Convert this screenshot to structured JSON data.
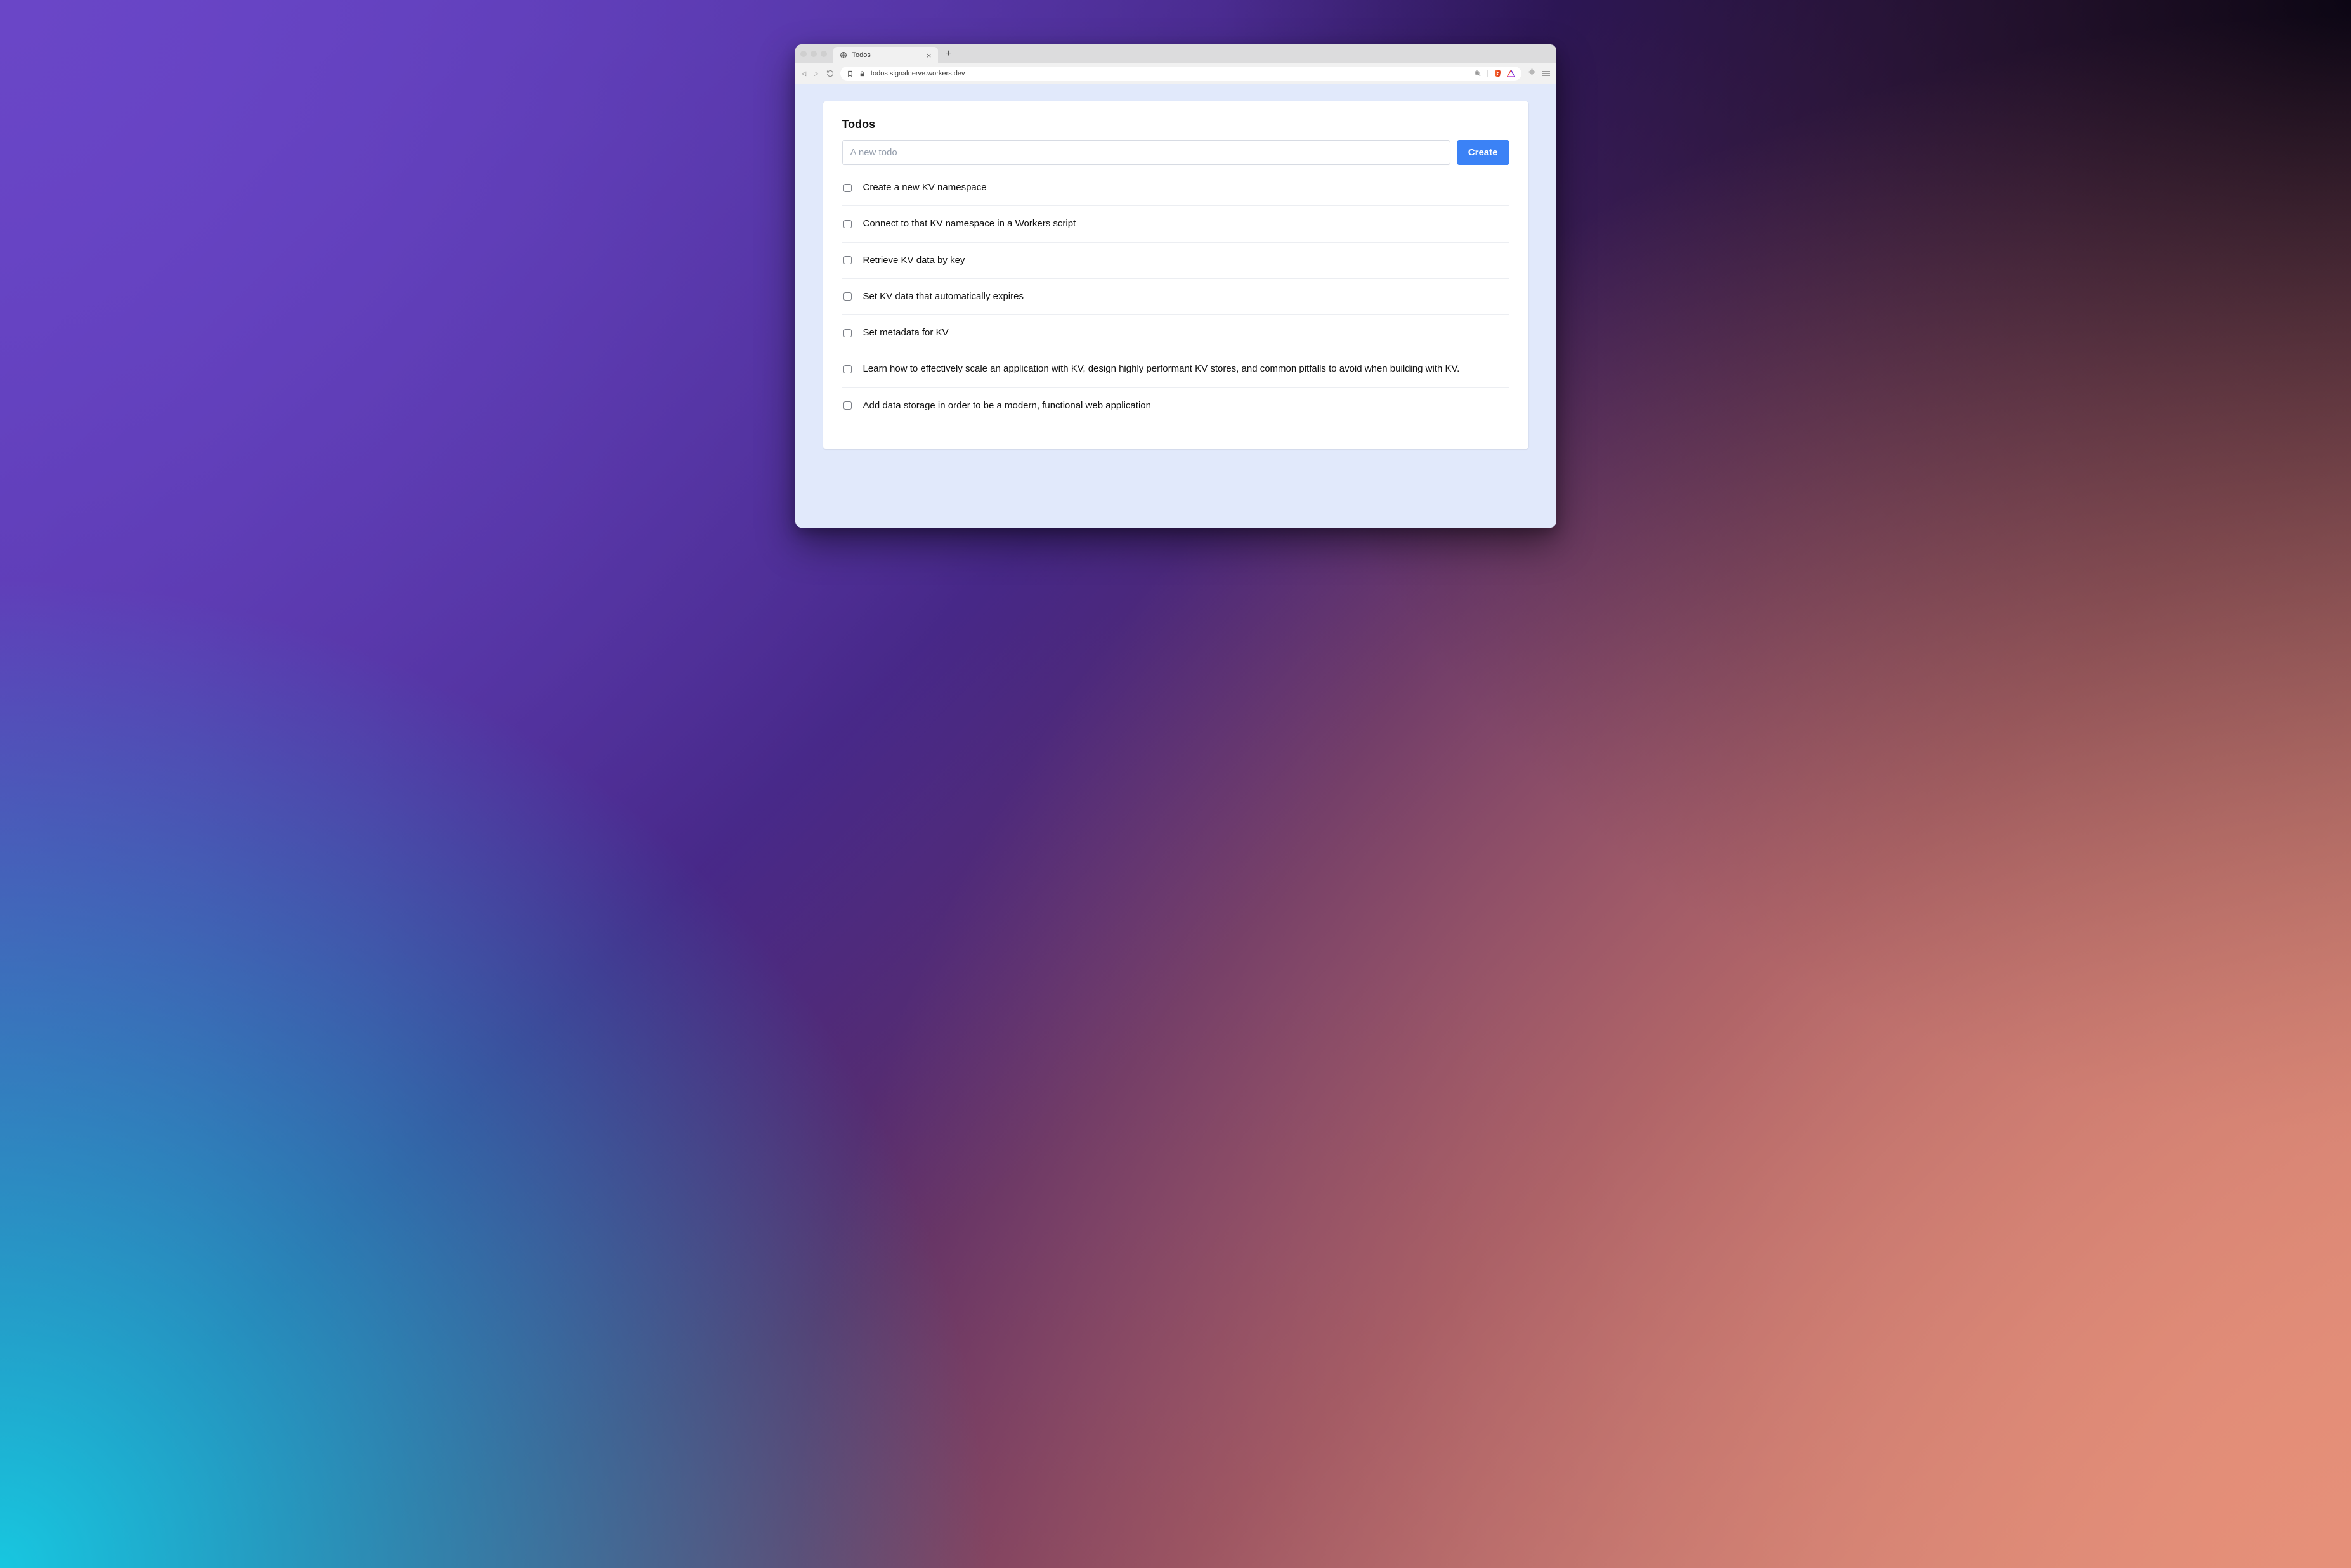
{
  "browser": {
    "tab_title": "Todos",
    "url": "todos.signalnerve.workers.dev"
  },
  "app": {
    "heading": "Todos",
    "input_placeholder": "A new todo",
    "create_label": "Create",
    "todos": [
      {
        "text": "Create a new KV namespace",
        "done": false
      },
      {
        "text": "Connect to that KV namespace in a Workers script",
        "done": false
      },
      {
        "text": "Retrieve KV data by key",
        "done": false
      },
      {
        "text": "Set KV data that automatically expires",
        "done": false
      },
      {
        "text": "Set metadata for KV",
        "done": false
      },
      {
        "text": "Learn how to effectively scale an application with KV, design highly performant KV stores, and common pitfalls to avoid when building with KV.",
        "done": false
      },
      {
        "text": "Add data storage in order to be a modern, functional web application",
        "done": false
      }
    ]
  }
}
